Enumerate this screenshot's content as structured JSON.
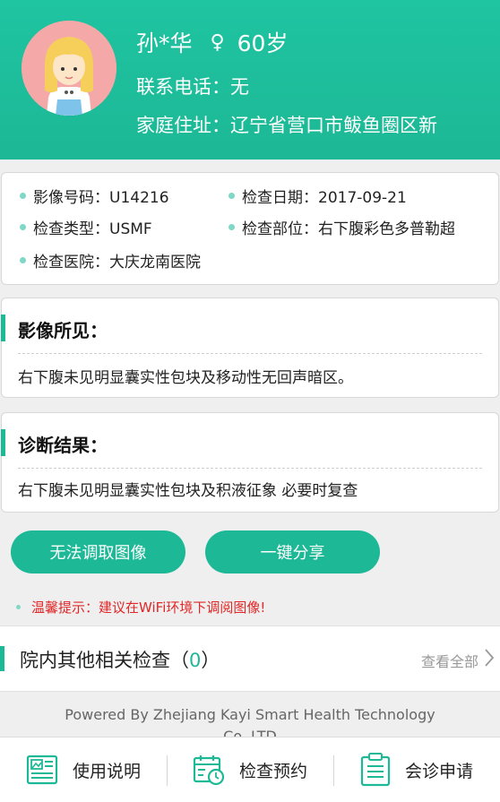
{
  "patient": {
    "name": "孙*华",
    "gender_symbol": "♀",
    "age": "60岁",
    "phone": "联系电话：无",
    "address": "家庭住址：辽宁省营口市鲅鱼圈区新"
  },
  "exam_info": {
    "image_no": "影像号码：U14216",
    "exam_date": "检查日期：2017-09-21",
    "exam_type": "检查类型：USMF",
    "exam_part": "检查部位：右下腹彩色多普勒超",
    "hospital": "检查医院：大庆龙南医院"
  },
  "findings": {
    "title": "影像所见：",
    "text": "右下腹未见明显囊实性包块及移动性无回声暗区。"
  },
  "diagnosis": {
    "title": "诊断结果：",
    "text": "右下腹未见明显囊实性包块及积液征象 必要时复查"
  },
  "buttons": {
    "no_image": "无法调取图像",
    "share": "一键分享"
  },
  "tip": "温馨提示：建议在WiFi环境下调阅图像!",
  "related": {
    "title": "院内其他相关检查（",
    "count": "0",
    "title_end": "）",
    "view_all": "查看全部"
  },
  "powered_by": "Powered By Zhejiang Kayi Smart Health Technology Co.,LTD",
  "tabs": [
    {
      "label": "使用说明",
      "icon": "image-doc-icon"
    },
    {
      "label": "检查预约",
      "icon": "calendar-clock-icon"
    },
    {
      "label": "会诊申请",
      "icon": "clipboard-icon"
    }
  ],
  "colors": {
    "accent": "#1db896",
    "tip_red": "#e12727",
    "avatar_bg": "#f4a9a8"
  }
}
